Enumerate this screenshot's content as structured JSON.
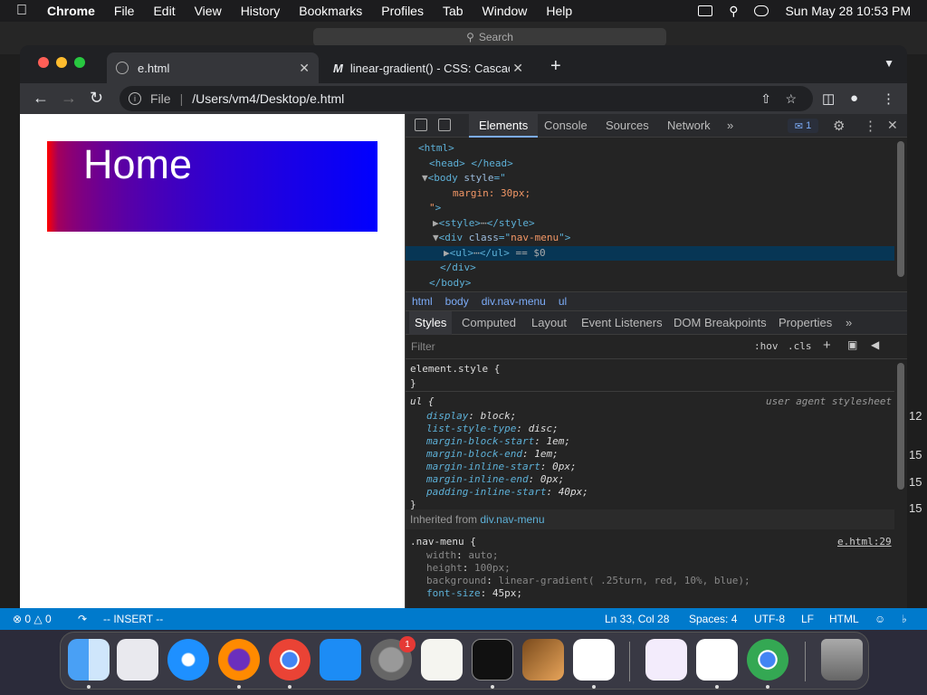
{
  "menubar": {
    "app": "Chrome",
    "items": [
      "File",
      "Edit",
      "View",
      "History",
      "Bookmarks",
      "Profiles",
      "Tab",
      "Window",
      "Help"
    ],
    "datetime": "Sun May 28  10:53 PM"
  },
  "background_window": {
    "search_placeholder": "Search",
    "right_numbers": [
      "12",
      "15",
      "15",
      "15"
    ]
  },
  "chrome": {
    "tabs": [
      {
        "title": "e.html",
        "active": true
      },
      {
        "title": "linear-gradient() - CSS: Cascad",
        "active": false
      }
    ],
    "omnibox": {
      "scheme_label": "File",
      "url": "/Users/vm4/Desktop/e.html"
    }
  },
  "page": {
    "nav_text": "Home"
  },
  "devtools": {
    "tabs": [
      "Elements",
      "Console",
      "Sources",
      "Network"
    ],
    "issues_count": "1",
    "dom_lines": [
      {
        "indent": 14,
        "parts": [
          {
            "c": "tag",
            "t": "<html>"
          }
        ]
      },
      {
        "indent": 26,
        "parts": [
          {
            "c": "tag",
            "t": "<head>"
          },
          {
            "c": "tri",
            "t": " "
          },
          {
            "c": "tag",
            "t": "</head>"
          }
        ]
      },
      {
        "indent": 18,
        "parts": [
          {
            "c": "tri",
            "t": "▼"
          },
          {
            "c": "tag",
            "t": "<body "
          },
          {
            "c": "attr",
            "t": "style"
          },
          {
            "c": "tag",
            "t": "=\""
          }
        ]
      },
      {
        "indent": 52,
        "parts": [
          {
            "c": "val",
            "t": "margin: 30px;"
          }
        ]
      },
      {
        "indent": 26,
        "parts": [
          {
            "c": "val",
            "t": "\""
          },
          {
            "c": "tag",
            "t": ">"
          }
        ]
      },
      {
        "indent": 30,
        "parts": [
          {
            "c": "tri",
            "t": "▶"
          },
          {
            "c": "tag",
            "t": "<style>"
          },
          {
            "c": "tri",
            "t": "⋯"
          },
          {
            "c": "tag",
            "t": "</style>"
          }
        ]
      },
      {
        "indent": 30,
        "parts": [
          {
            "c": "tri",
            "t": "▼"
          },
          {
            "c": "tag",
            "t": "<div "
          },
          {
            "c": "attr",
            "t": "class"
          },
          {
            "c": "tag",
            "t": "=\""
          },
          {
            "c": "val",
            "t": "nav-menu"
          },
          {
            "c": "tag",
            "t": "\">"
          }
        ]
      },
      {
        "indent": 42,
        "selected": true,
        "parts": [
          {
            "c": "tri",
            "t": "▶"
          },
          {
            "c": "tag",
            "t": "<ul>"
          },
          {
            "c": "tri",
            "t": "⋯"
          },
          {
            "c": "tag",
            "t": "</ul>"
          },
          {
            "c": "tri",
            "t": " == $0"
          }
        ]
      },
      {
        "indent": 38,
        "parts": [
          {
            "c": "tag",
            "t": "</div>"
          }
        ]
      },
      {
        "indent": 26,
        "parts": [
          {
            "c": "tag",
            "t": "</body>"
          }
        ]
      },
      {
        "indent": 14,
        "parts": [
          {
            "c": "tag",
            "t": "</html>"
          }
        ]
      }
    ],
    "breadcrumbs": [
      "html",
      "body",
      "div.nav-menu",
      "ul"
    ],
    "subtabs": [
      "Styles",
      "Computed",
      "Layout",
      "Event Listeners",
      "DOM Breakpoints",
      "Properties"
    ],
    "filter_placeholder": "Filter",
    "hov": ":hov",
    "cls": ".cls",
    "element_style": "element.style {",
    "close_brace": "}",
    "ul_selector": "ul {",
    "ul_origin": "user agent stylesheet",
    "ul_props": [
      {
        "p": "display",
        "v": "block;"
      },
      {
        "p": "list-style-type",
        "v": "disc;"
      },
      {
        "p": "margin-block-start",
        "v": "1em;"
      },
      {
        "p": "margin-block-end",
        "v": "1em;"
      },
      {
        "p": "margin-inline-start",
        "v": "0px;"
      },
      {
        "p": "margin-inline-end",
        "v": "0px;"
      },
      {
        "p": "padding-inline-start",
        "v": "40px;"
      }
    ],
    "inherited_label": "Inherited from",
    "inherited_from": "div.nav-menu",
    "nav_selector": ".nav-menu {",
    "nav_origin": "e.html:29",
    "nav_props": [
      {
        "p": "width",
        "v": "auto;"
      },
      {
        "p": "height",
        "v": "100px;"
      },
      {
        "p": "background",
        "v": "linear-gradient(  .25turn,  red, 10%,  blue);"
      },
      {
        "p": "font-size",
        "v": "45px;"
      }
    ]
  },
  "statusbar": {
    "errors": "0",
    "warnings": "0",
    "mode": "-- INSERT --",
    "position": "Ln 33, Col 28",
    "spaces": "Spaces: 4",
    "encoding": "UTF-8",
    "eol": "LF",
    "language": "HTML"
  },
  "dock": {
    "apps": [
      "finder-icon",
      "launchpad-icon",
      "safari-icon",
      "firefox-icon",
      "chrome-icon",
      "app-store-icon",
      "system-settings-icon",
      "textedit-icon",
      "terminal-icon",
      "garageband-icon",
      "vscode-icon",
      "visual-studio-icon",
      "freeform-icon",
      "chrome-alt-icon",
      "trash-icon"
    ],
    "settings_badge": "1"
  },
  "colors": {
    "statusbar": "#007acc",
    "selected_dom": "#073655"
  }
}
